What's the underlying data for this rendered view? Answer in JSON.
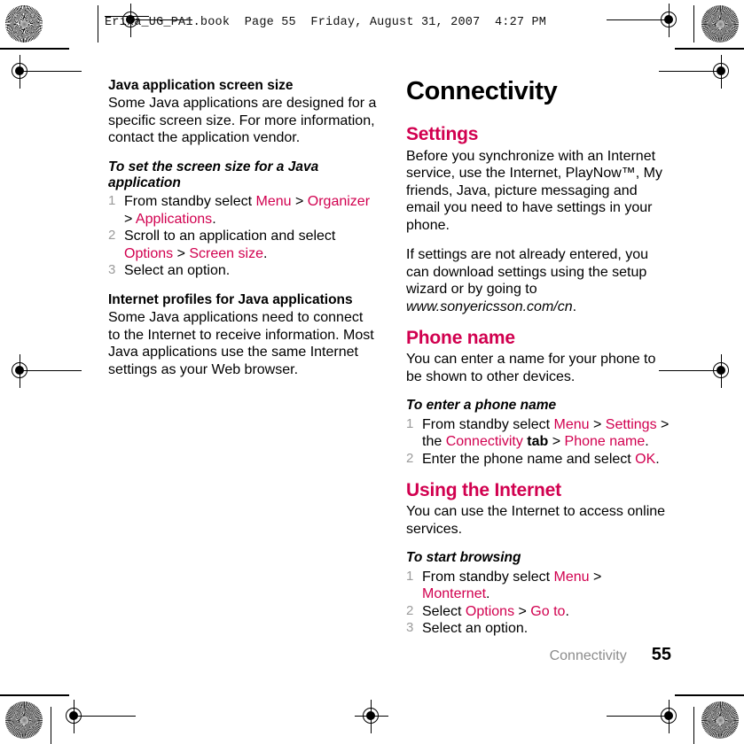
{
  "header": {
    "slug": "Erika_UG_PA1.book  Page 55  Friday, August 31, 2007  4:27 PM"
  },
  "accent_color": "#D1004F",
  "muted_color": "#8c8c8c",
  "left_column": {
    "sub_heading_1": "Java application screen size",
    "paragraph_1": "Some Java applications are designed for a specific screen size. For more information, contact the application vendor.",
    "task_heading_1": "To set the screen size for a Java application",
    "steps_1": [
      {
        "num": "1",
        "parts": [
          {
            "text": "From standby select ",
            "style": "plain"
          },
          {
            "text": "Menu",
            "style": "accent"
          },
          {
            "text": " > ",
            "style": "plain"
          },
          {
            "text": "Organizer",
            "style": "accent"
          },
          {
            "text": " > ",
            "style": "plain"
          },
          {
            "text": "Applications",
            "style": "accent"
          },
          {
            "text": ".",
            "style": "plain"
          }
        ]
      },
      {
        "num": "2",
        "parts": [
          {
            "text": "Scroll to an application and select ",
            "style": "plain"
          },
          {
            "text": "Options",
            "style": "accent"
          },
          {
            "text": " > ",
            "style": "plain"
          },
          {
            "text": "Screen size",
            "style": "accent"
          },
          {
            "text": ".",
            "style": "plain"
          }
        ]
      },
      {
        "num": "3",
        "parts": [
          {
            "text": "Select an option.",
            "style": "plain"
          }
        ]
      }
    ],
    "sub_heading_2": "Internet profiles for Java applications",
    "paragraph_2": "Some Java applications need to connect to the Internet to receive information. Most Java applications use the same Internet settings as your Web browser."
  },
  "right_column": {
    "chapter_title": "Connectivity",
    "section_1": {
      "heading": "Settings",
      "paragraph_1": "Before you synchronize with an Internet service, use the Internet, PlayNow™, My friends, Java, picture messaging and email you need to have settings in your phone.",
      "paragraph_2_parts": [
        {
          "text": "If settings are not already entered, you can download settings using the setup wizard or by going to ",
          "style": "plain"
        },
        {
          "text": "www.sonyericsson.com/cn",
          "style": "italic"
        },
        {
          "text": ".",
          "style": "plain"
        }
      ]
    },
    "section_2": {
      "heading": "Phone name",
      "paragraph_1": "You can enter a name for your phone to be shown to other devices.",
      "task_heading": "To enter a phone name",
      "steps": [
        {
          "num": "1",
          "parts": [
            {
              "text": "From standby select ",
              "style": "plain"
            },
            {
              "text": "Menu",
              "style": "accent"
            },
            {
              "text": " > ",
              "style": "plain"
            },
            {
              "text": "Settings",
              "style": "accent"
            },
            {
              "text": " > the ",
              "style": "plain"
            },
            {
              "text": "Connectivity",
              "style": "accent"
            },
            {
              "text": " tab",
              "style": "bold"
            },
            {
              "text": " > ",
              "style": "plain"
            },
            {
              "text": "Phone name",
              "style": "accent"
            },
            {
              "text": ".",
              "style": "plain"
            }
          ]
        },
        {
          "num": "2",
          "parts": [
            {
              "text": "Enter the phone name and select ",
              "style": "plain"
            },
            {
              "text": "OK",
              "style": "accent"
            },
            {
              "text": ".",
              "style": "plain"
            }
          ]
        }
      ]
    },
    "section_3": {
      "heading": "Using the Internet",
      "paragraph_1": "You can use the Internet to access online services.",
      "task_heading": "To start browsing",
      "steps": [
        {
          "num": "1",
          "parts": [
            {
              "text": "From standby select ",
              "style": "plain"
            },
            {
              "text": "Menu",
              "style": "accent"
            },
            {
              "text": " > ",
              "style": "plain"
            },
            {
              "text": "Monternet",
              "style": "accent"
            },
            {
              "text": ".",
              "style": "plain"
            }
          ]
        },
        {
          "num": "2",
          "parts": [
            {
              "text": "Select ",
              "style": "plain"
            },
            {
              "text": "Options",
              "style": "accent"
            },
            {
              "text": " > ",
              "style": "plain"
            },
            {
              "text": "Go to",
              "style": "accent"
            },
            {
              "text": ".",
              "style": "plain"
            }
          ]
        },
        {
          "num": "3",
          "parts": [
            {
              "text": "Select an option.",
              "style": "plain"
            }
          ]
        }
      ]
    }
  },
  "footer": {
    "chapter": "Connectivity",
    "page_number": "55"
  },
  "print_marks": {
    "registration_icon": "registration-target-icon",
    "star_icon": "star-target-icon"
  }
}
